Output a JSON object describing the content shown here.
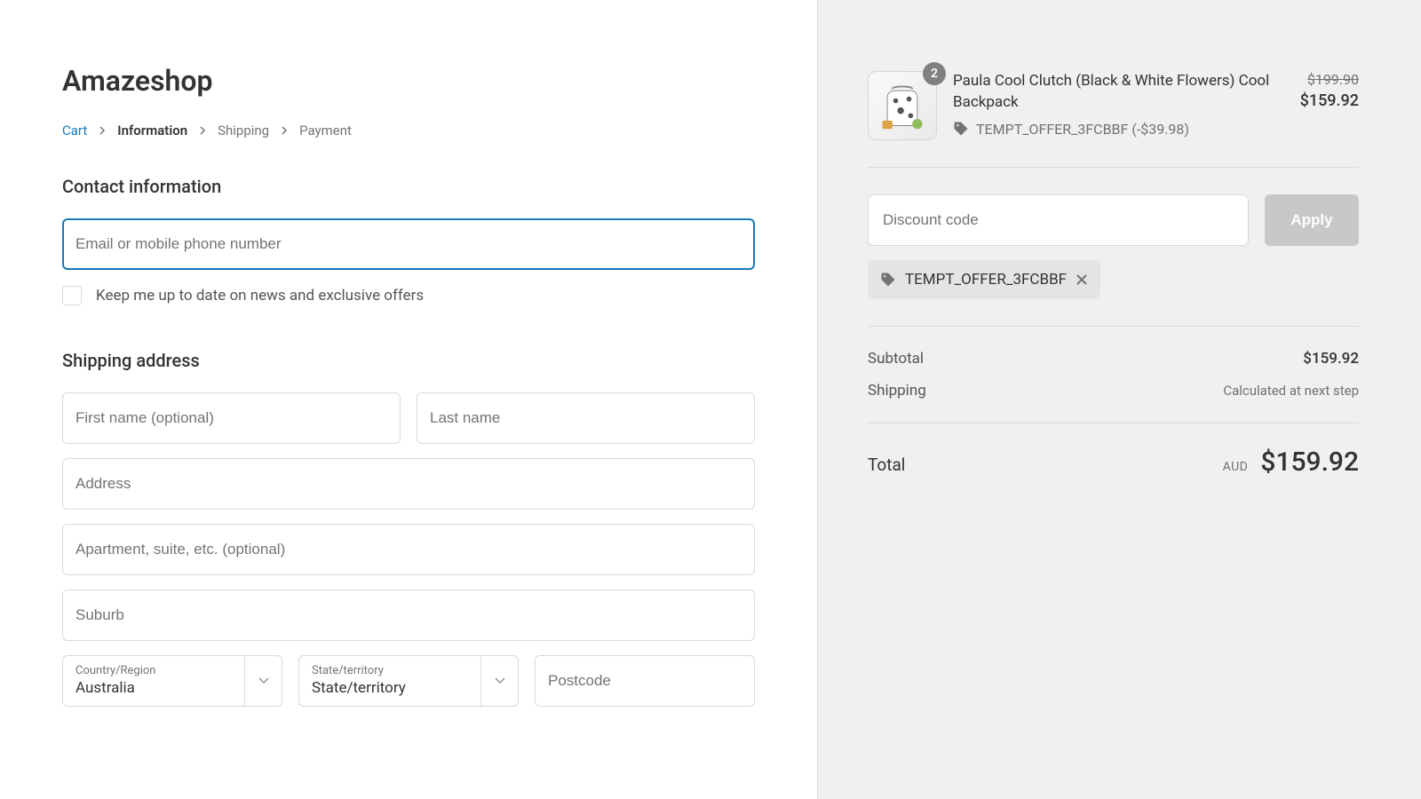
{
  "shop": {
    "name": "Amazeshop"
  },
  "breadcrumbs": {
    "cart": "Cart",
    "information": "Information",
    "shipping": "Shipping",
    "payment": "Payment"
  },
  "contact": {
    "heading": "Contact information",
    "email_placeholder": "Email or mobile phone number",
    "newsletter_label": "Keep me up to date on news and exclusive offers"
  },
  "shipping": {
    "heading": "Shipping address",
    "first_name_placeholder": "First name (optional)",
    "last_name_placeholder": "Last name",
    "address_placeholder": "Address",
    "address2_placeholder": "Apartment, suite, etc. (optional)",
    "suburb_placeholder": "Suburb",
    "country_label": "Country/Region",
    "country_value": "Australia",
    "state_label": "State/territory",
    "state_value": "State/territory",
    "postcode_placeholder": "Postcode"
  },
  "summary": {
    "product": {
      "qty": "2",
      "title": "Paula Cool Clutch (Black & White Flowers) Cool Backpack",
      "discount_code_line": "TEMPT_OFFER_3FCBBF (-$39.98)",
      "compare_price": "$199.90",
      "price": "$159.92"
    },
    "discount": {
      "placeholder": "Discount code",
      "apply_label": "Apply",
      "applied_code": "TEMPT_OFFER_3FCBBF"
    },
    "subtotal_label": "Subtotal",
    "subtotal_value": "$159.92",
    "shipping_label": "Shipping",
    "shipping_note": "Calculated at next step",
    "total_label": "Total",
    "currency": "AUD",
    "total_value": "$159.92"
  }
}
